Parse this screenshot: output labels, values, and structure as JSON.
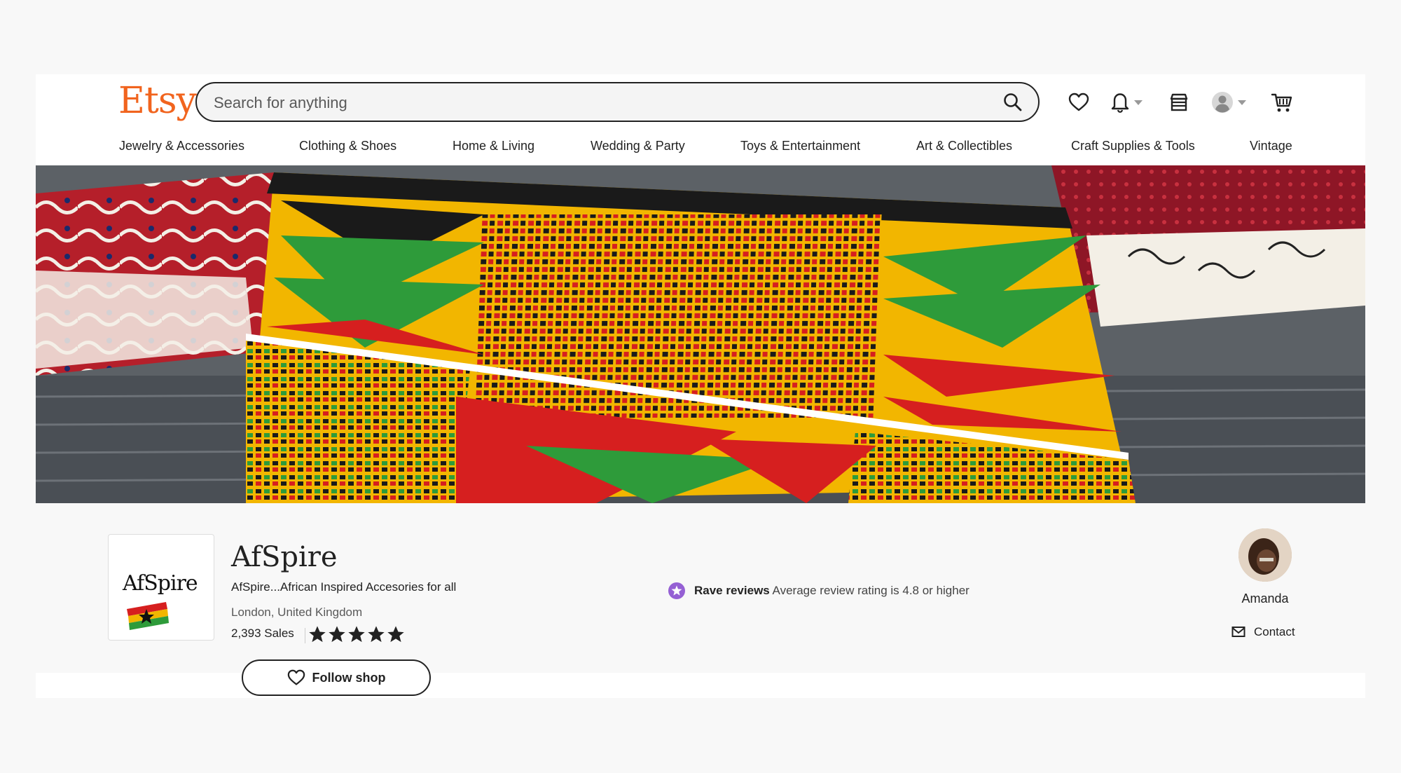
{
  "header": {
    "logo": "Etsy",
    "search_placeholder": "Search for anything",
    "icons": [
      "favorites-heart-icon",
      "bell-icon",
      "shop-manager-icon",
      "avatar-icon",
      "cart-icon"
    ]
  },
  "nav": {
    "items": [
      "Jewelry & Accessories",
      "Clothing & Shoes",
      "Home & Living",
      "Wedding & Party",
      "Toys & Entertainment",
      "Art & Collectibles",
      "Craft Supplies & Tools",
      "Vintage"
    ]
  },
  "shop": {
    "logo_text": "AfSpire",
    "name": "AfSpire",
    "tagline": "AfSpire...African Inspired Accesories for all",
    "location": "London, United Kingdom",
    "sales": "2,393 Sales",
    "rating_stars": 5,
    "follow_label": "Follow shop"
  },
  "badge": {
    "title": "Rave reviews",
    "description": "Average review rating is 4.8 or higher"
  },
  "owner": {
    "name": "Amanda",
    "contact_label": "Contact"
  },
  "colors": {
    "brand": "#f1641e",
    "badge_purple": "#9560d4"
  }
}
